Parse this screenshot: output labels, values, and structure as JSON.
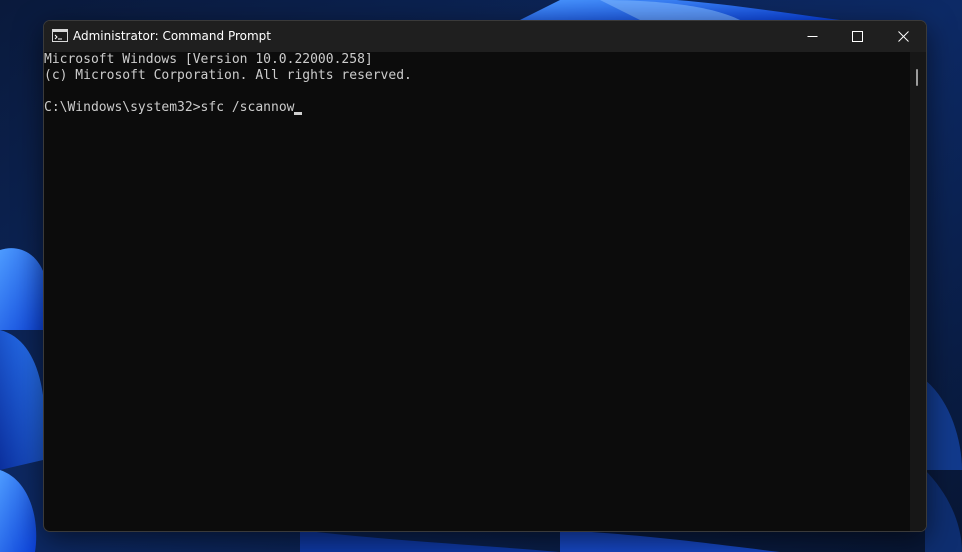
{
  "window": {
    "title": "Administrator: Command Prompt",
    "icon": "command-prompt-icon",
    "controls": {
      "minimize": "minimize-icon",
      "maximize": "maximize-icon",
      "close": "close-icon"
    }
  },
  "terminal": {
    "lines": [
      "Microsoft Windows [Version 10.0.22000.258]",
      "(c) Microsoft Corporation. All rights reserved."
    ],
    "prompt": "C:\\Windows\\system32>",
    "input": "sfc /scannow"
  },
  "colors": {
    "terminal_background": "#0c0c0c",
    "terminal_text": "#cccccc",
    "titlebar": "#1f1f1f",
    "wallpaper_accent": "#1e6fff"
  }
}
